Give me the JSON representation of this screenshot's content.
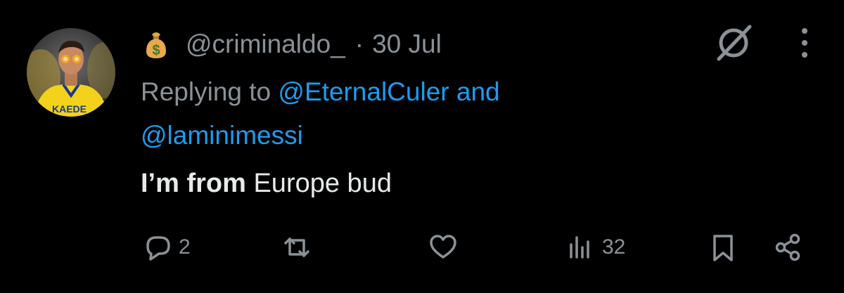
{
  "tweet": {
    "author_emoji": "money-bag-emoji",
    "handle": "@criminaldo_",
    "separator": "·",
    "date": "30 Jul",
    "replying_prefix": "Replying to",
    "mention_1": "@EternalCuler",
    "and_word": "and",
    "mention_2": "@laminimessi",
    "body_bold": "I’m from",
    "body_rest": " Europe bud"
  },
  "actions": {
    "reply_count": "2",
    "retweet_count": "",
    "like_count": "",
    "views_count": "32"
  },
  "colors": {
    "background": "#000000",
    "text": "#e7e9ea",
    "muted": "#8b9197",
    "link": "#1d9bf0"
  }
}
